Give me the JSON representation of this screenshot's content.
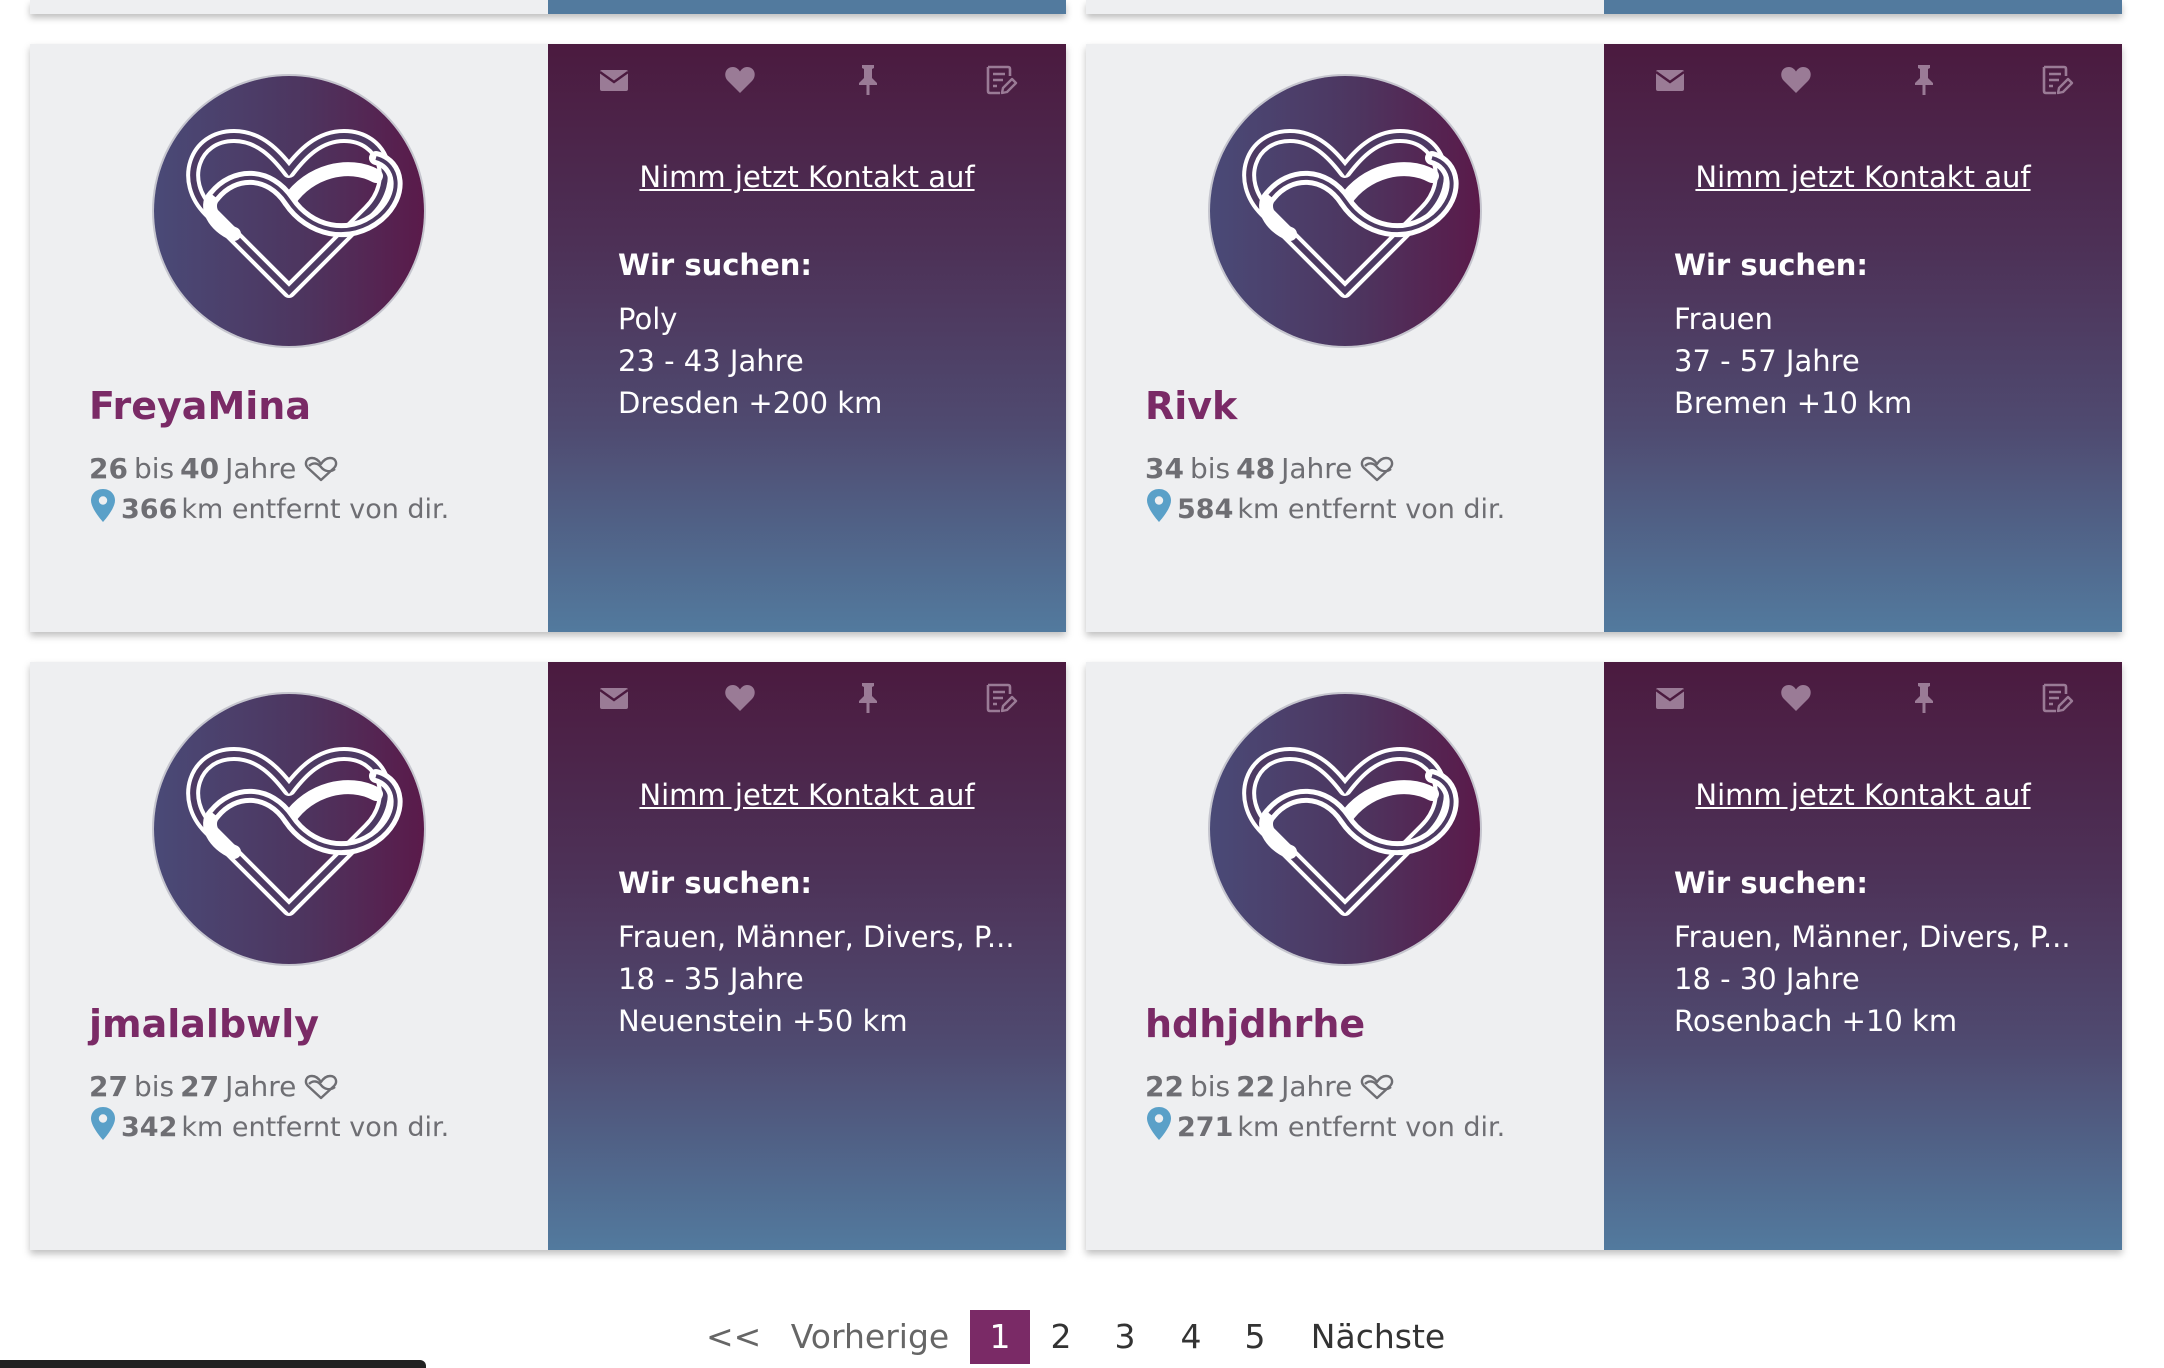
{
  "colors": {
    "username": "#7a2a66",
    "card_left_bg": "#eeeff1",
    "gradient_top": "#4b1a3f",
    "gradient_bottom": "#527a9e",
    "active_page": "#7a2a66",
    "pin": "#5aa0c8"
  },
  "labels": {
    "contact": "Nimm jetzt Kontakt auf",
    "search_heading": "Wir suchen:",
    "bis": "bis",
    "jahre": "Jahre",
    "km_suffix": "km entfernt von dir."
  },
  "icons": [
    "mail-icon",
    "heart-icon",
    "pin-icon",
    "note-edit-icon",
    "infinity-heart-icon",
    "location-pin-icon"
  ],
  "profiles": [
    {
      "username": "FreyaMina",
      "age_min": "26",
      "age_max": "40",
      "distance": "366",
      "search": [
        "Poly",
        "23 - 43 Jahre",
        "Dresden +200 km"
      ]
    },
    {
      "username": "Rivk",
      "age_min": "34",
      "age_max": "48",
      "distance": "584",
      "search": [
        "Frauen",
        "37 - 57 Jahre",
        "Bremen +10 km"
      ]
    },
    {
      "username": "jmalalbwly",
      "age_min": "27",
      "age_max": "27",
      "distance": "342",
      "search": [
        "Frauen, Männer, Divers, P...",
        "18 - 35 Jahre",
        "Neuenstein +50 km"
      ]
    },
    {
      "username": "hdhjdhrhe",
      "age_min": "22",
      "age_max": "22",
      "distance": "271",
      "search": [
        "Frauen, Männer, Divers, P...",
        "18 - 30 Jahre",
        "Rosenbach +10 km"
      ]
    }
  ],
  "pagination": {
    "first": "<<",
    "prev": "Vorherige",
    "pages": [
      "1",
      "2",
      "3",
      "4",
      "5"
    ],
    "current": "1",
    "next": "Nächste"
  }
}
